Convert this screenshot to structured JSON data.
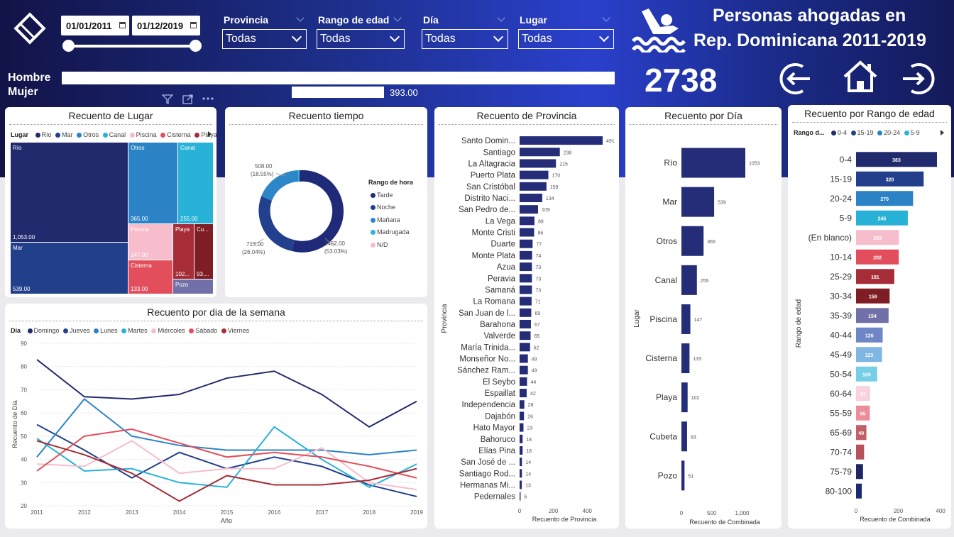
{
  "header": {
    "title_line1": "Personas ahogadas en",
    "title_line2": "Rep. Dominicana 2011-2019",
    "date_start": "01/01/2011",
    "date_end": "01/12/2019",
    "total": "2738",
    "filters": [
      {
        "label": "Provincia",
        "value": "Todas"
      },
      {
        "label": "Rango de edad",
        "value": "Todas"
      },
      {
        "label": "Día",
        "value": "Todas"
      },
      {
        "label": "Lugar",
        "value": "Todas"
      }
    ],
    "hombre_label": "Hombre",
    "mujer_label": "Mujer",
    "mujer_value": "393.00"
  },
  "lugar": {
    "title": "Recuento de Lugar",
    "legend_title": "Lugar",
    "legend": [
      {
        "name": "Río",
        "color": "#222a6e"
      },
      {
        "name": "Mar",
        "color": "#213f8a"
      },
      {
        "name": "Otros",
        "color": "#2b83c6"
      },
      {
        "name": "Canal",
        "color": "#29b2d8"
      },
      {
        "name": "Piscina",
        "color": "#f7bdcc"
      },
      {
        "name": "Cisterna",
        "color": "#e34e5c"
      },
      {
        "name": "Playa",
        "color": "#a62d37"
      }
    ],
    "cells": {
      "rio": {
        "name": "Río",
        "value": "1,053.00"
      },
      "mar": {
        "name": "Mar",
        "value": "539.00"
      },
      "otros": {
        "name": "Otros",
        "value": "365.00"
      },
      "canal": {
        "name": "Canal",
        "value": "255.00"
      },
      "piscina": {
        "name": "Piscina",
        "value": "147.00"
      },
      "cisterna": {
        "name": "Cisterna",
        "value": "133.00"
      },
      "playa": {
        "name": "Playa",
        "value": "102..."
      },
      "cubeta": {
        "name": "Cu...",
        "value": "93...."
      },
      "pozo": {
        "name": "Pozo",
        "value": ""
      }
    }
  },
  "tiempo": {
    "title": "Recuento tiempo",
    "legend_title": "Rango de hora",
    "legend": [
      {
        "name": "Tarde",
        "color": "#1f2a78"
      },
      {
        "name": "Noche",
        "color": "#23408e"
      },
      {
        "name": "Mañana",
        "color": "#2d86c8"
      },
      {
        "name": "Madrugada",
        "color": "#2bb4d9"
      },
      {
        "name": "N/D",
        "color": "#f7bdcc"
      }
    ],
    "labels": {
      "tarde": "1452.00",
      "tarde_pct": "(53.03%)",
      "noche": "713.00",
      "noche_pct": "(26.04%)",
      "manana": "508.00",
      "manana_pct": "(18.55%)"
    }
  },
  "semana": {
    "title": "Recuento por dia de la semana",
    "legend_title": "Día",
    "xlabel": "Año",
    "ylabel": "Recuento de Día"
  },
  "provincia": {
    "title": "Recuento de Provincia",
    "ylabel": "Provincia",
    "xlabel": "Recuento de Provincia"
  },
  "dia": {
    "title": "Recuento por Día",
    "ylabel": "Lugar",
    "xlabel": "Recuento de Combinada"
  },
  "edad": {
    "title": "Recuento por Rango de edad",
    "legend_title": "Rango d...",
    "legend": [
      {
        "name": "0-4",
        "color": "#222a6e"
      },
      {
        "name": "15-19",
        "color": "#213f8a"
      },
      {
        "name": "20-24",
        "color": "#2b83c6"
      },
      {
        "name": "5-9",
        "color": "#29b2d8"
      }
    ],
    "ylabel": "Rango de edad",
    "xlabel": "Recuento de Combinada"
  },
  "chart_data": [
    {
      "type": "line",
      "chart": "semana",
      "x": [
        2011,
        2012,
        2013,
        2014,
        2015,
        2016,
        2017,
        2018,
        2019
      ],
      "ylim": [
        20,
        90
      ],
      "yticks": [
        20,
        30,
        40,
        50,
        60,
        70,
        80,
        90
      ],
      "series": [
        {
          "name": "Domingo",
          "color": "#222a6e",
          "values": [
            83,
            67,
            66,
            68,
            75,
            78,
            68,
            54,
            65
          ]
        },
        {
          "name": "Jueves",
          "color": "#213f8a",
          "values": [
            55,
            44,
            32,
            43,
            36,
            41,
            37,
            29,
            24
          ]
        },
        {
          "name": "Lunes",
          "color": "#2b83c6",
          "values": [
            41,
            66,
            50,
            46,
            44,
            44,
            44,
            42,
            44
          ]
        },
        {
          "name": "Martes",
          "color": "#29b2d8",
          "values": [
            49,
            35,
            36,
            30,
            28,
            54,
            40,
            28,
            38
          ]
        },
        {
          "name": "Miércoles",
          "color": "#f7bdcc",
          "values": [
            38,
            37,
            48,
            34,
            36,
            36,
            45,
            30,
            27
          ]
        },
        {
          "name": "Sábado",
          "color": "#e34e5c",
          "values": [
            35,
            50,
            53,
            47,
            41,
            43,
            41,
            37,
            32
          ]
        },
        {
          "name": "Viernes",
          "color": "#a62d37",
          "values": [
            48,
            42,
            34,
            22,
            33,
            29,
            29,
            31,
            36
          ]
        }
      ]
    },
    {
      "type": "bar",
      "chart": "provincia",
      "categories": [
        "Santo Domin...",
        "Santiago",
        "La Altagracia",
        "Puerto Plata",
        "San Cristóbal",
        "Distrito Naci...",
        "San Pedro de...",
        "La Vega",
        "Monte Cristi",
        "Duarte",
        "Monte Plata",
        "Azua",
        "Peravia",
        "Samaná",
        "La Romana",
        "San Juan de l...",
        "Barahona",
        "Valverde",
        "María Trinida...",
        "Monseñor No...",
        "Sánchez Ram...",
        "El Seybo",
        "Espaillat",
        "Independencia",
        "Dajabón",
        "Hato Mayor",
        "Bahoruco",
        "Elías Pina",
        "San José de ...",
        "Santiago Rod...",
        "Hermanas Mi...",
        "Pedernales"
      ],
      "values": [
        491,
        238,
        215,
        170,
        159,
        134,
        109,
        88,
        86,
        77,
        74,
        73,
        73,
        73,
        71,
        69,
        67,
        65,
        62,
        49,
        49,
        44,
        42,
        28,
        26,
        23,
        18,
        18,
        14,
        14,
        13,
        6
      ],
      "xticks": [
        0,
        200,
        400
      ],
      "color": "#252d78"
    },
    {
      "type": "bar",
      "chart": "dia",
      "categories": [
        "Río",
        "Mar",
        "Otros",
        "Canal",
        "Piscina",
        "Cisterna",
        "Playa",
        "Cubeta",
        "Pozo"
      ],
      "values": [
        1053,
        539,
        365,
        255,
        147,
        133,
        102,
        93,
        51
      ],
      "xticks": [
        0,
        500,
        1000
      ],
      "xtick_labels": [
        "0",
        "500",
        "1,000"
      ],
      "color": "#252d78"
    },
    {
      "type": "bar",
      "chart": "edad",
      "categories": [
        "0-4",
        "15-19",
        "20-24",
        "5-9",
        "(En blanco)",
        "10-14",
        "25-29",
        "30-34",
        "35-39",
        "40-44",
        "45-49",
        "50-54",
        "60-64",
        "55-59",
        "65-69",
        "70-74",
        "75-79",
        "80-100"
      ],
      "values": [
        383,
        320,
        270,
        245,
        203,
        202,
        181,
        159,
        154,
        126,
        123,
        100,
        67,
        65,
        49,
        38,
        33,
        27
      ],
      "labels": [
        "383",
        "320",
        "270",
        "245",
        "203",
        "202",
        "181",
        "159",
        "154",
        "126",
        "123",
        "100",
        "67",
        "65",
        "49",
        "",
        "",
        ""
      ],
      "colors": [
        "#222a6e",
        "#213f8a",
        "#2b83c6",
        "#29b2d8",
        "#f7bdcc",
        "#e34e5c",
        "#a62d37",
        "#7f1d25",
        "#7270a8",
        "#6f86c6",
        "#7fb6e4",
        "#76cfe6",
        "#f8d2dc",
        "#ec8d99",
        "#c25e66",
        "#b8525a",
        "#1e2665",
        "#1e2a70"
      ],
      "xticks": [
        0,
        200,
        400
      ]
    }
  ]
}
